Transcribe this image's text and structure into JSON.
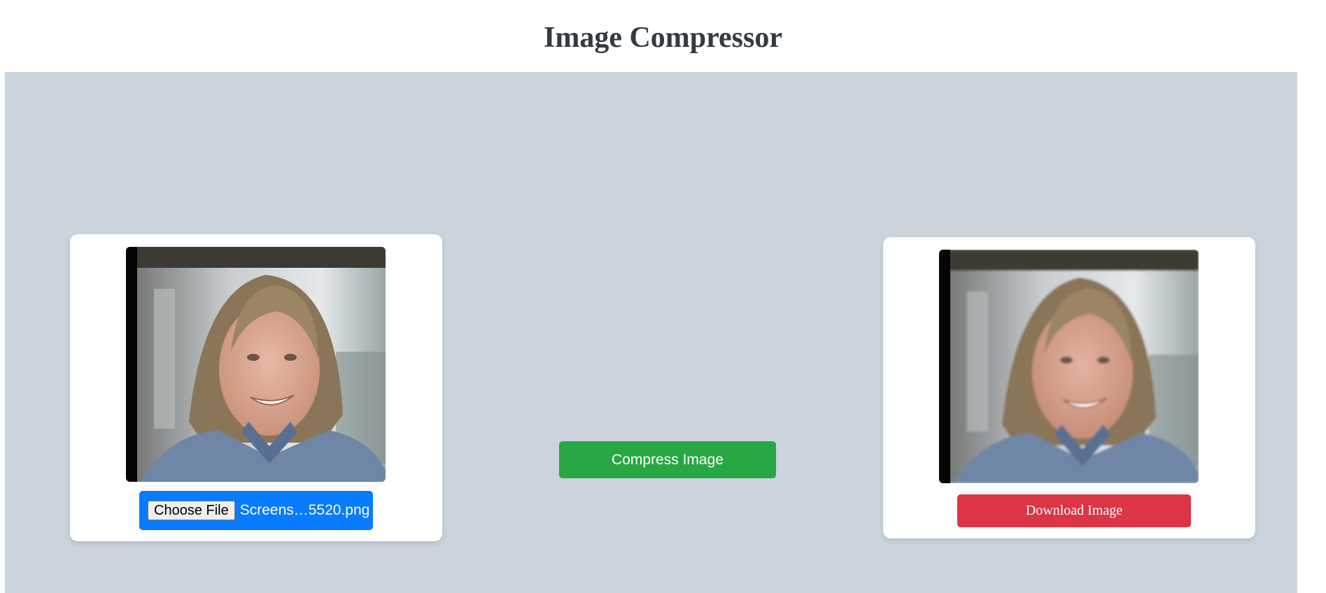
{
  "header": {
    "title": "Image Compressor"
  },
  "original": {
    "photo_label": "portrait-photo",
    "choose_file_label": "Choose File",
    "file_name": "Screens…5520.png"
  },
  "actions": {
    "compress_label": "Compress Image"
  },
  "compressed": {
    "photo_label": "portrait-photo-compressed",
    "download_label": "Download Image"
  },
  "colors": {
    "workspace_bg": "#cbd3dd",
    "file_picker_bg": "#087bff",
    "compress_bg": "#28a745",
    "download_bg": "#dc3545",
    "title_color": "#333b45"
  }
}
